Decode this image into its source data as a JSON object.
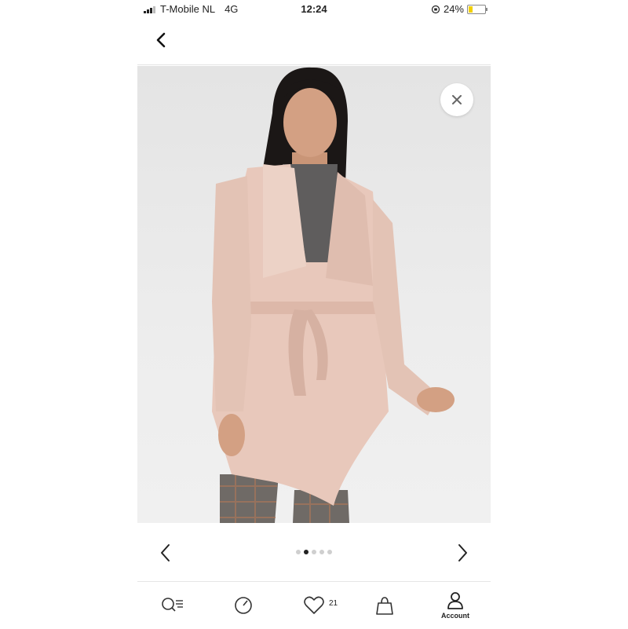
{
  "status_bar": {
    "carrier": "T-Mobile NL",
    "network": "4G",
    "time": "12:24",
    "battery_text": "24%",
    "battery_level": 0.24,
    "battery_color": "#f2d000"
  },
  "nav": {
    "back_icon": "chevron-left-icon"
  },
  "gallery": {
    "close_icon": "close-icon",
    "image_alt": "Model wearing a pink waterfall coat",
    "prev_icon": "chevron-left-icon",
    "next_icon": "chevron-right-icon",
    "total_images": 5,
    "active_index": 1
  },
  "tab_bar": {
    "tabs": [
      {
        "icon": "search-list-icon",
        "label": ""
      },
      {
        "icon": "circle-icon",
        "label": ""
      },
      {
        "icon": "heart-icon",
        "label": "",
        "count": "21"
      },
      {
        "icon": "bag-icon",
        "label": ""
      },
      {
        "icon": "account-icon",
        "label": "Account"
      }
    ]
  }
}
